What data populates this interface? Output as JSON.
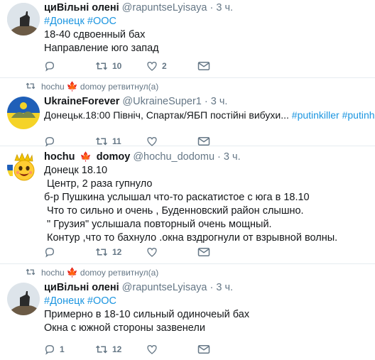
{
  "tweets": [
    {
      "author": "циВільні олені",
      "handle": "@rapuntseLyisaya",
      "time": "3 ч.",
      "dot": "·",
      "hashtags": [
        "#Донецк",
        "#ООС"
      ],
      "lines": [
        "18-40 сдвоенный бах",
        "Направление юго запад"
      ],
      "retweets": "10",
      "likes": "2"
    },
    {
      "retweeted_by": "hochu",
      "retweeted_by_suffix": "domoy ретвитнул(а)",
      "author": "UkraineForever",
      "handle": "@UkraineSuper1",
      "time": "3 ч.",
      "dot": "·",
      "text": "Донецьк.18:00 Північ, Спартак/ЯБП  постійні вибухи...",
      "hashtags": [
        "#putinkiller",
        "#putinhuilo"
      ],
      "retweets": "11"
    },
    {
      "author": "hochu",
      "author_suffix": "domoy",
      "handle": "@hochu_dodomu",
      "time": "3 ч.",
      "dot": "·",
      "lines": [
        "Донецк 18.10",
        " Центр, 2 раза гупнуло",
        "б-р Пушкина услышал что-то раскатистое с юга в 18.10",
        " Что то сильно и очень , Буденновский район слышно.",
        " \" Грузия\" услышала повторный очень мощный.",
        " Контур ,что то бахнуло .окна вздрогнули от взрывной волны."
      ],
      "retweets": "12"
    },
    {
      "retweeted_by": "hochu",
      "retweeted_by_suffix": "domoy ретвитнул(а)",
      "author": "циВільні олені",
      "handle": "@rapuntseLyisaya",
      "time": "3 ч.",
      "dot": "·",
      "hashtags": [
        "#Донецк",
        "#ООС"
      ],
      "lines": [
        "Примерно в 18-10 сильный одиночеый бах",
        "Окна с южной стороны зазвенели"
      ],
      "replies": "1",
      "retweets": "12"
    }
  ],
  "icons": {
    "leaf": "🍁",
    "leaf_color": "#e0245e",
    "link_color": "#1b95e0",
    "muted_color": "#657786"
  }
}
